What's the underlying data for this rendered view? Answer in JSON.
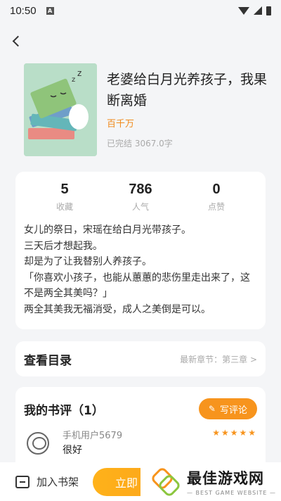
{
  "status_bar": {
    "time": "10:50",
    "app_badge": "A"
  },
  "book": {
    "title": "老婆给白月光养孩子，我果断离婚",
    "author": "百千万",
    "status": "已完结 3067.0字"
  },
  "stats": [
    {
      "value": "5",
      "label": "收藏"
    },
    {
      "value": "786",
      "label": "人气"
    },
    {
      "value": "0",
      "label": "点赞"
    }
  ],
  "summary": "女儿的祭日，宋瑶在给白月光带孩子。\n三天后才想起我。\n却是为了让我替别人养孩子。\n「你喜欢小孩子，也能从蕙蕙的悲伤里走出来了，这不是两全其美吗？」\n两全其美我无福消受，成人之美倒是可以。",
  "catalog": {
    "title": "查看目录",
    "latest": "最新章节：第三章 >"
  },
  "reviews": {
    "title": "我的书评（1）",
    "write_label": "写评论",
    "items": [
      {
        "user": "手机用户5679",
        "text": "很好",
        "rating": "★★★★★"
      }
    ]
  },
  "bottom": {
    "shelf_label": "加入书架",
    "read_label": "立即"
  },
  "watermark": {
    "main": "最佳游戏网",
    "sub": "— BEST GAME WEBSITE —"
  },
  "colors": {
    "accent": "#f7941d",
    "author": "#f08a1c"
  }
}
